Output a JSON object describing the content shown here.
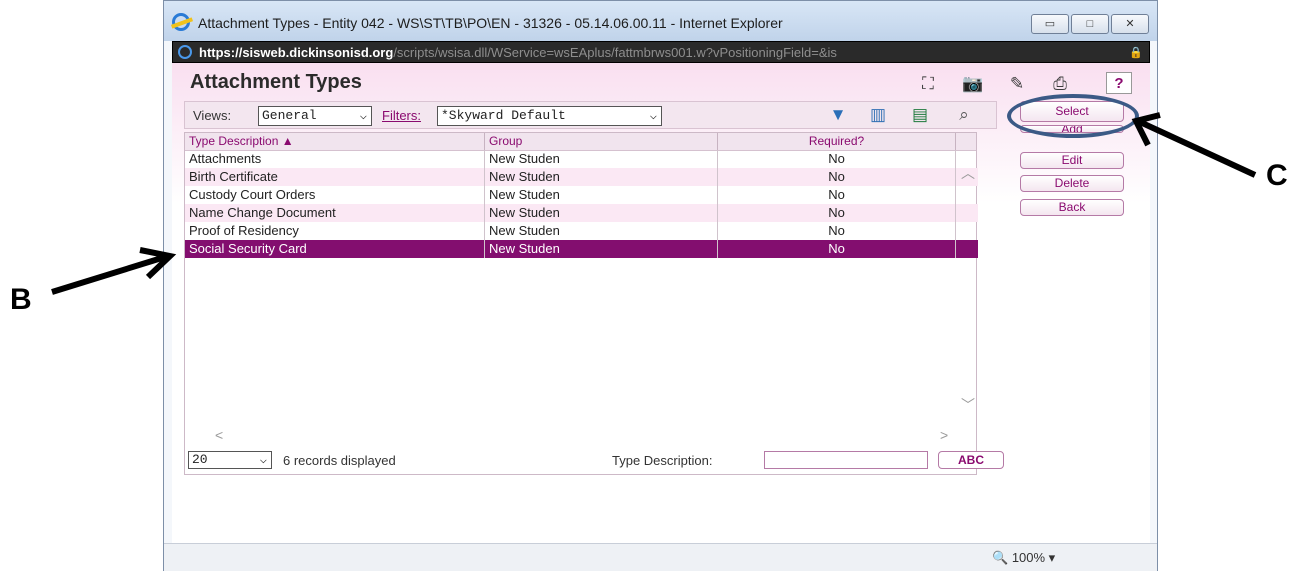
{
  "window": {
    "title": "Attachment Types - Entity 042 - WS\\ST\\TB\\PO\\EN - 31326 - 05.14.06.00.11 - Internet Explorer",
    "url_prefix": "https://sisweb.",
    "url_domain": "dickinsonisd.org",
    "url_rest": "/scripts/wsisa.dll/WService=wsEAplus/fattmbrws001.w?vPositioningField=&is"
  },
  "app": {
    "title": "Attachment Types",
    "views_label": "Views:",
    "views_value": "General",
    "filters_label": "Filters:",
    "filters_value": "*Skyward Default"
  },
  "table": {
    "headers": {
      "type_description": "Type Description ▲",
      "group": "Group",
      "required": "Required?"
    },
    "rows": [
      {
        "type": "Attachments",
        "group": "New Studen",
        "required": "No"
      },
      {
        "type": "Birth Certificate",
        "group": "New Studen",
        "required": "No"
      },
      {
        "type": "Custody Court Orders",
        "group": "New Studen",
        "required": "No"
      },
      {
        "type": "Name Change Document",
        "group": "New Studen",
        "required": "No"
      },
      {
        "type": "Proof of Residency",
        "group": "New Studen",
        "required": "No"
      },
      {
        "type": "Social Security Card",
        "group": "New Studen",
        "required": "No"
      }
    ],
    "selected_index": 5
  },
  "footer": {
    "page_size": "20",
    "records": "6 records displayed",
    "search_label": "Type Description:",
    "search_value": "",
    "abc_label": "ABC"
  },
  "actions": {
    "select": "Select",
    "add": "Add",
    "edit": "Edit",
    "delete": "Delete",
    "back": "Back"
  },
  "status": {
    "zoom": "100%"
  },
  "annotations": {
    "b": "B",
    "c": "C"
  },
  "colors": {
    "accent": "#830e6f",
    "annotation_circle": "#3b5a86"
  }
}
